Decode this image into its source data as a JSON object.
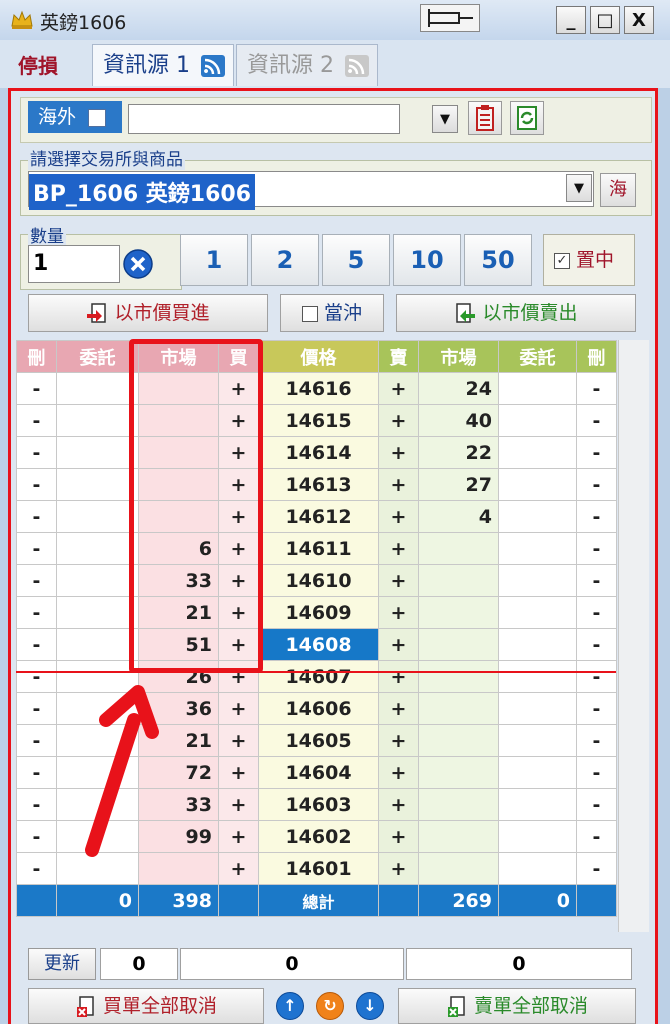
{
  "window": {
    "title": "英鎊1606",
    "min": "_",
    "max": "□",
    "close": "X"
  },
  "tabs": {
    "stoploss": "停損",
    "source1": "資訊源 1",
    "source2": "資訊源 2"
  },
  "toolbar": {
    "overseas_label": "海外",
    "exchange_value": ""
  },
  "product": {
    "group_label": "請選擇交易所與商品",
    "selected": "BP_1606 英鎊1606",
    "hai_button": "海"
  },
  "quantity": {
    "group_label": "數量",
    "value": "1",
    "presets": [
      "1",
      "2",
      "5",
      "10",
      "50"
    ],
    "center_label": "置中",
    "center_checked": true
  },
  "orders": {
    "buy_market": "以市價買進",
    "daytrade": "當沖",
    "sell_market": "以市價賣出"
  },
  "ladder": {
    "headers": [
      "刪",
      "委託",
      "市場",
      "買",
      "價格",
      "賣",
      "市場",
      "委託",
      "刪"
    ],
    "rows": [
      {
        "del_l": "-",
        "ent_b": "",
        "mkt_b": "",
        "buy": "+",
        "price": "14616",
        "sell": "+",
        "mkt_s": "24",
        "ent_s": "",
        "del_r": "-"
      },
      {
        "del_l": "-",
        "ent_b": "",
        "mkt_b": "",
        "buy": "+",
        "price": "14615",
        "sell": "+",
        "mkt_s": "40",
        "ent_s": "",
        "del_r": "-"
      },
      {
        "del_l": "-",
        "ent_b": "",
        "mkt_b": "",
        "buy": "+",
        "price": "14614",
        "sell": "+",
        "mkt_s": "22",
        "ent_s": "",
        "del_r": "-"
      },
      {
        "del_l": "-",
        "ent_b": "",
        "mkt_b": "",
        "buy": "+",
        "price": "14613",
        "sell": "+",
        "mkt_s": "27",
        "ent_s": "",
        "del_r": "-"
      },
      {
        "del_l": "-",
        "ent_b": "",
        "mkt_b": "",
        "buy": "+",
        "price": "14612",
        "sell": "+",
        "mkt_s": "4",
        "ent_s": "",
        "del_r": "-"
      },
      {
        "del_l": "-",
        "ent_b": "",
        "mkt_b": "6",
        "buy": "+",
        "price": "14611",
        "sell": "+",
        "mkt_s": "",
        "ent_s": "",
        "del_r": "-"
      },
      {
        "del_l": "-",
        "ent_b": "",
        "mkt_b": "33",
        "buy": "+",
        "price": "14610",
        "sell": "+",
        "mkt_s": "",
        "ent_s": "",
        "del_r": "-"
      },
      {
        "del_l": "-",
        "ent_b": "",
        "mkt_b": "21",
        "buy": "+",
        "price": "14609",
        "sell": "+",
        "mkt_s": "",
        "ent_s": "",
        "del_r": "-"
      },
      {
        "del_l": "-",
        "ent_b": "",
        "mkt_b": "51",
        "buy": "+",
        "price": "14608",
        "sell": "+",
        "mkt_s": "",
        "ent_s": "",
        "del_r": "-",
        "current": true
      },
      {
        "del_l": "-",
        "ent_b": "",
        "mkt_b": "26",
        "buy": "+",
        "price": "14607",
        "sell": "+",
        "mkt_s": "",
        "ent_s": "",
        "del_r": "-"
      },
      {
        "del_l": "-",
        "ent_b": "",
        "mkt_b": "36",
        "buy": "+",
        "price": "14606",
        "sell": "+",
        "mkt_s": "",
        "ent_s": "",
        "del_r": "-"
      },
      {
        "del_l": "-",
        "ent_b": "",
        "mkt_b": "21",
        "buy": "+",
        "price": "14605",
        "sell": "+",
        "mkt_s": "",
        "ent_s": "",
        "del_r": "-"
      },
      {
        "del_l": "-",
        "ent_b": "",
        "mkt_b": "72",
        "buy": "+",
        "price": "14604",
        "sell": "+",
        "mkt_s": "",
        "ent_s": "",
        "del_r": "-"
      },
      {
        "del_l": "-",
        "ent_b": "",
        "mkt_b": "33",
        "buy": "+",
        "price": "14603",
        "sell": "+",
        "mkt_s": "",
        "ent_s": "",
        "del_r": "-"
      },
      {
        "del_l": "-",
        "ent_b": "",
        "mkt_b": "99",
        "buy": "+",
        "price": "14602",
        "sell": "+",
        "mkt_s": "",
        "ent_s": "",
        "del_r": "-"
      },
      {
        "del_l": "-",
        "ent_b": "",
        "mkt_b": "",
        "buy": "+",
        "price": "14601",
        "sell": "+",
        "mkt_s": "",
        "ent_s": "",
        "del_r": "-"
      }
    ],
    "summary": {
      "ent_b": "0",
      "mkt_b": "398",
      "label": "總計",
      "mkt_s": "269",
      "ent_s": "0"
    }
  },
  "footer": {
    "refresh": "更新",
    "left_val": "0",
    "mid_val": "0",
    "right_val": "0",
    "cancel_buy": "買單全部取消",
    "cancel_sell": "賣單全部取消"
  },
  "colors": {
    "accent_red": "#e8121a",
    "highlight_blue": "#1678c8"
  }
}
